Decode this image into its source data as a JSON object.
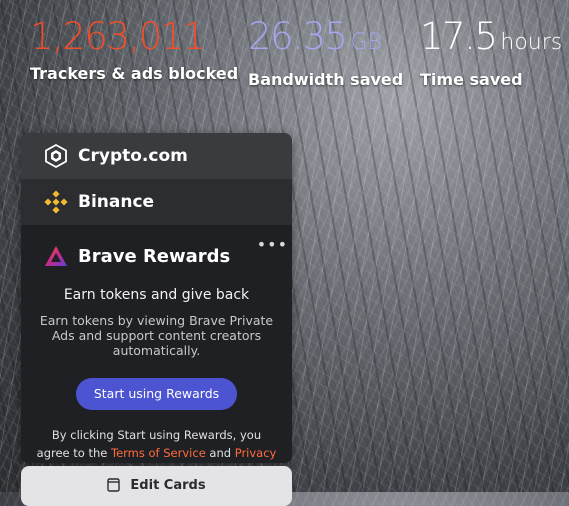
{
  "stats": [
    {
      "value": "1,263,011",
      "unit": "",
      "label": "Trackers & ads blocked",
      "color": "#f04f2d"
    },
    {
      "value": "26.35",
      "unit": "GB",
      "label": "Bandwidth saved",
      "color": "#a9a4f0"
    },
    {
      "value": "17.5",
      "unit": "hours",
      "label": "Time saved",
      "color": "#ffffff"
    }
  ],
  "cards": {
    "crypto": {
      "label": "Crypto.com",
      "icon": "crypto-com-logo-icon"
    },
    "binance": {
      "label": "Binance",
      "icon": "binance-logo-icon"
    },
    "rewards": {
      "label": "Brave Rewards",
      "icon": "brave-rewards-logo-icon",
      "more": "•••",
      "title": "Earn tokens and give back",
      "description": "Earn tokens by viewing Brave Private Ads and support content creators automatically.",
      "button": "Start using Rewards",
      "terms_prefix": "By clicking Start using Rewards, you agree to the",
      "terms_link": "Terms of Service",
      "terms_and": "and",
      "privacy_link": "Privacy Policy",
      "terms_suffix": "."
    }
  },
  "edit_cards": {
    "label": "Edit Cards",
    "icon": "edit-cards-icon"
  },
  "colors": {
    "accent": "#4c54d2",
    "link": "#ff6b3d"
  }
}
